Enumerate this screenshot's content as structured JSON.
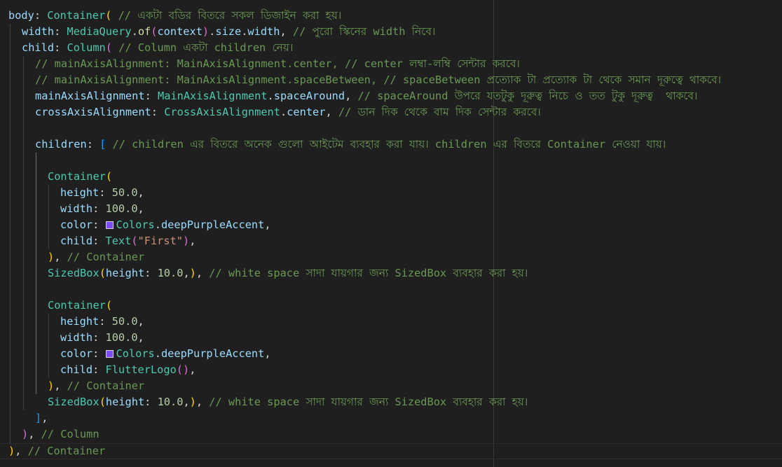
{
  "colors": {
    "background": "#1f1f1f",
    "swatch_deep_purple_accent": "#7c4dff"
  },
  "code_lines": [
    [
      {
        "t": "body",
        "c": "prop"
      },
      {
        "t": ": ",
        "c": "txt"
      },
      {
        "t": "Container",
        "c": "cls"
      },
      {
        "t": "( ",
        "c": "p1"
      },
      {
        "t": "// একটা বডির বিতরে সকল ডিজাইন করা হয়।",
        "c": "cmt"
      }
    ],
    [
      {
        "t": "width",
        "c": "prop"
      },
      {
        "t": ": ",
        "c": "txt"
      },
      {
        "t": "MediaQuery",
        "c": "cls"
      },
      {
        "t": ".",
        "c": "txt"
      },
      {
        "t": "of",
        "c": "kw"
      },
      {
        "t": "(",
        "c": "p2"
      },
      {
        "t": "context",
        "c": "prop"
      },
      {
        "t": ")",
        "c": "p2"
      },
      {
        "t": ".",
        "c": "txt"
      },
      {
        "t": "size",
        "c": "prop"
      },
      {
        "t": ".",
        "c": "txt"
      },
      {
        "t": "width",
        "c": "prop"
      },
      {
        "t": ", ",
        "c": "txt"
      },
      {
        "t": "// পুরো স্কিনের width নিবে।",
        "c": "cmt"
      }
    ],
    [
      {
        "t": "child",
        "c": "prop"
      },
      {
        "t": ": ",
        "c": "txt"
      },
      {
        "t": "Column",
        "c": "cls"
      },
      {
        "t": "( ",
        "c": "p2"
      },
      {
        "t": "// Column একটা children নেয়।",
        "c": "cmt"
      }
    ],
    [
      {
        "t": "// mainAxisAlignment: MainAxisAlignment.center, // center লম্বা-লম্বি সেন্টার করবে।",
        "c": "cmt"
      }
    ],
    [
      {
        "t": "// mainAxisAlignment: MainAxisAlignment.spaceBetween, // spaceBetween প্রত্যোক টা প্রত্যোক টা থেকে সমান দূরুত্বে থাকবে।",
        "c": "cmt"
      }
    ],
    [
      {
        "t": "mainAxisAlignment",
        "c": "prop"
      },
      {
        "t": ": ",
        "c": "txt"
      },
      {
        "t": "MainAxisAlignment",
        "c": "cls"
      },
      {
        "t": ".",
        "c": "txt"
      },
      {
        "t": "spaceAround",
        "c": "prop"
      },
      {
        "t": ", ",
        "c": "txt"
      },
      {
        "t": "// spaceAround উপরে যতটুকু দূরুত্ব নিচে ও তত টুকু দূরুত্ব  থাকবে।",
        "c": "cmt"
      }
    ],
    [
      {
        "t": "crossAxisAlignment",
        "c": "prop"
      },
      {
        "t": ": ",
        "c": "txt"
      },
      {
        "t": "CrossAxisAlignment",
        "c": "cls"
      },
      {
        "t": ".",
        "c": "txt"
      },
      {
        "t": "center",
        "c": "prop"
      },
      {
        "t": ", ",
        "c": "txt"
      },
      {
        "t": "// ডান দিক থেকে বাম দিক সেন্টার করবে।",
        "c": "cmt"
      }
    ],
    [],
    [
      {
        "t": "children",
        "c": "prop"
      },
      {
        "t": ": ",
        "c": "txt"
      },
      {
        "t": "[ ",
        "c": "p3"
      },
      {
        "t": "// children এর বিতরে অনেক গুলো আইটেম ব্যবহার করা যায়। children এর বিতরে Container নেওয়া যায়।",
        "c": "cmt"
      }
    ],
    [],
    [
      {
        "t": "Container",
        "c": "cls"
      },
      {
        "t": "(",
        "c": "p1"
      }
    ],
    [
      {
        "t": "height",
        "c": "prop"
      },
      {
        "t": ": ",
        "c": "txt"
      },
      {
        "t": "50.0",
        "c": "num"
      },
      {
        "t": ",",
        "c": "txt"
      }
    ],
    [
      {
        "t": "width",
        "c": "prop"
      },
      {
        "t": ": ",
        "c": "txt"
      },
      {
        "t": "100.0",
        "c": "num"
      },
      {
        "t": ",",
        "c": "txt"
      }
    ],
    [
      {
        "t": "color",
        "c": "prop"
      },
      {
        "t": ": ",
        "c": "txt"
      },
      {
        "swatch": "swatch_deep_purple_accent"
      },
      {
        "t": "Colors",
        "c": "cls"
      },
      {
        "t": ".",
        "c": "txt"
      },
      {
        "t": "deepPurpleAccent",
        "c": "prop"
      },
      {
        "t": ",",
        "c": "txt"
      }
    ],
    [
      {
        "t": "child",
        "c": "prop"
      },
      {
        "t": ": ",
        "c": "txt"
      },
      {
        "t": "Text",
        "c": "cls"
      },
      {
        "t": "(",
        "c": "p2"
      },
      {
        "t": "\"First\"",
        "c": "str"
      },
      {
        "t": ")",
        "c": "p2"
      },
      {
        "t": ",",
        "c": "txt"
      }
    ],
    [
      {
        "t": ")",
        "c": "p1"
      },
      {
        "t": ", ",
        "c": "txt"
      },
      {
        "t": "// Container",
        "c": "cmt"
      }
    ],
    [
      {
        "t": "SizedBox",
        "c": "cls"
      },
      {
        "t": "(",
        "c": "p1"
      },
      {
        "t": "height",
        "c": "prop"
      },
      {
        "t": ": ",
        "c": "txt"
      },
      {
        "t": "10.0",
        "c": "num"
      },
      {
        "t": ",",
        "c": "txt"
      },
      {
        "t": ")",
        "c": "p1"
      },
      {
        "t": ", ",
        "c": "txt"
      },
      {
        "t": "// white space সাদা যায়গার জন্য SizedBox ব্যবহার করা হয়।",
        "c": "cmt"
      }
    ],
    [],
    [
      {
        "t": "Container",
        "c": "cls"
      },
      {
        "t": "(",
        "c": "p1"
      }
    ],
    [
      {
        "t": "height",
        "c": "prop"
      },
      {
        "t": ": ",
        "c": "txt"
      },
      {
        "t": "50.0",
        "c": "num"
      },
      {
        "t": ",",
        "c": "txt"
      }
    ],
    [
      {
        "t": "width",
        "c": "prop"
      },
      {
        "t": ": ",
        "c": "txt"
      },
      {
        "t": "100.0",
        "c": "num"
      },
      {
        "t": ",",
        "c": "txt"
      }
    ],
    [
      {
        "t": "color",
        "c": "prop"
      },
      {
        "t": ": ",
        "c": "txt"
      },
      {
        "swatch": "swatch_deep_purple_accent"
      },
      {
        "t": "Colors",
        "c": "cls"
      },
      {
        "t": ".",
        "c": "txt"
      },
      {
        "t": "deepPurpleAccent",
        "c": "prop"
      },
      {
        "t": ",",
        "c": "txt"
      }
    ],
    [
      {
        "t": "child",
        "c": "prop"
      },
      {
        "t": ": ",
        "c": "txt"
      },
      {
        "t": "FlutterLogo",
        "c": "cls"
      },
      {
        "t": "()",
        "c": "p2"
      },
      {
        "t": ",",
        "c": "txt"
      }
    ],
    [
      {
        "t": ")",
        "c": "p1"
      },
      {
        "t": ", ",
        "c": "txt"
      },
      {
        "t": "// Container",
        "c": "cmt"
      }
    ],
    [
      {
        "t": "SizedBox",
        "c": "cls"
      },
      {
        "t": "(",
        "c": "p1"
      },
      {
        "t": "height",
        "c": "prop"
      },
      {
        "t": ": ",
        "c": "txt"
      },
      {
        "t": "10.0",
        "c": "num"
      },
      {
        "t": ",",
        "c": "txt"
      },
      {
        "t": ")",
        "c": "p1"
      },
      {
        "t": ", ",
        "c": "txt"
      },
      {
        "t": "// white space সাদা যায়গার জন্য SizedBox ব্যবহার করা হয়।",
        "c": "cmt"
      }
    ],
    [
      {
        "t": "]",
        "c": "p3"
      },
      {
        "t": ",",
        "c": "txt"
      }
    ],
    [
      {
        "t": ")",
        "c": "p2"
      },
      {
        "t": ", ",
        "c": "txt"
      },
      {
        "t": "// Column",
        "c": "cmt"
      }
    ],
    [
      {
        "t": ")",
        "c": "p1"
      },
      {
        "t": ", ",
        "c": "txt"
      },
      {
        "t": "// Container",
        "c": "cmt"
      }
    ]
  ]
}
